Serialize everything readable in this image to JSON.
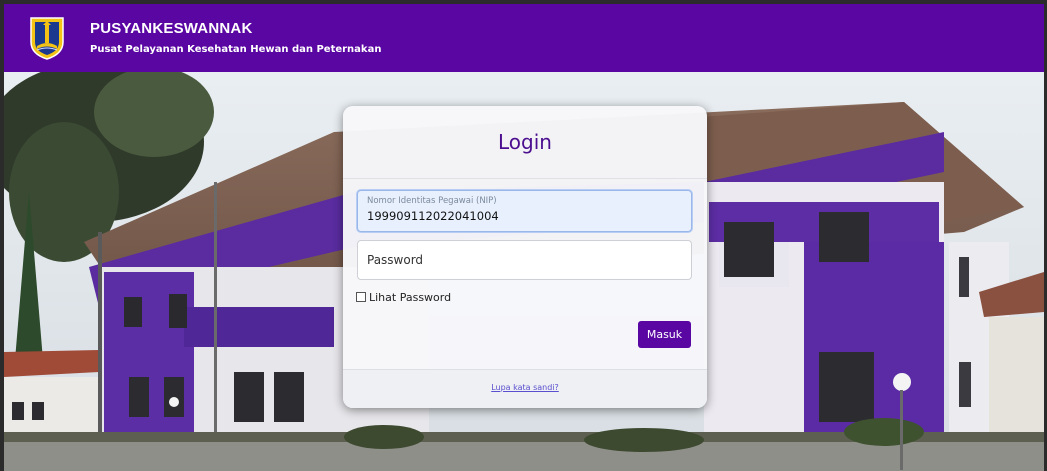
{
  "header": {
    "title": "PUSYANKESWANNAK",
    "subtitle": "Pusat Pelayanan Kesehatan Hewan dan Peternakan"
  },
  "login": {
    "title": "Login",
    "nip_label": "Nomor Identitas Pegawai (NIP)",
    "nip_value": "199909112022041004",
    "password_placeholder": "Password",
    "show_password_label": "Lihat Password",
    "submit_label": "Masuk",
    "forgot_label": "Lupa kata sandi?"
  },
  "colors": {
    "brand": "#5a06a3",
    "accent_purple": "#4b0e8f"
  },
  "icons": {
    "logo": "jakarta-emblem-icon"
  }
}
